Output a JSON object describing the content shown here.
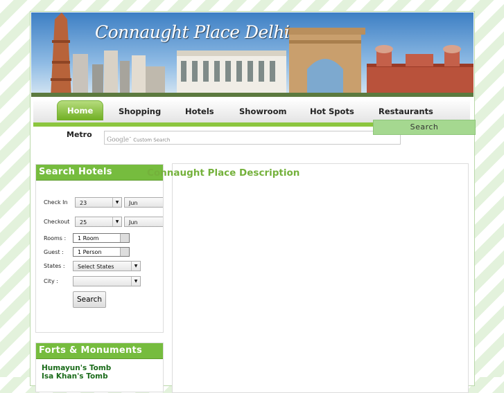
{
  "banner": {
    "title": "Connaught Place Delhi"
  },
  "nav": {
    "items": [
      "Home",
      "Shopping",
      "Hotels",
      "Showroom",
      "Hot Spots",
      "Restaurants"
    ],
    "active": "Home"
  },
  "search": {
    "label": "Metro",
    "logo": "Google",
    "placeholder": "Custom Search",
    "button": "Search"
  },
  "hotel_search": {
    "heading": "Search Hotels",
    "checkin": {
      "label": "Check In",
      "day": "23",
      "month": "Jun"
    },
    "checkout": {
      "label": "Checkout",
      "day": "25",
      "month": "Jun"
    },
    "rooms": {
      "label": "Rooms :",
      "value": "1 Room"
    },
    "guest": {
      "label": "Guest :",
      "value": "1 Person"
    },
    "states": {
      "label": "States :",
      "value": "Select States"
    },
    "city": {
      "label": "City :",
      "value": ""
    },
    "button": "Search"
  },
  "forts": {
    "heading": "Forts & Monuments",
    "items": [
      "Humayun's Tomb",
      "Isa Khan's Tomb"
    ]
  },
  "main": {
    "title": "Connaught Place Description"
  },
  "colors": {
    "accent_green": "#8cc63f",
    "heading_green": "#76bc3e",
    "link_green": "#1a6b1a"
  }
}
